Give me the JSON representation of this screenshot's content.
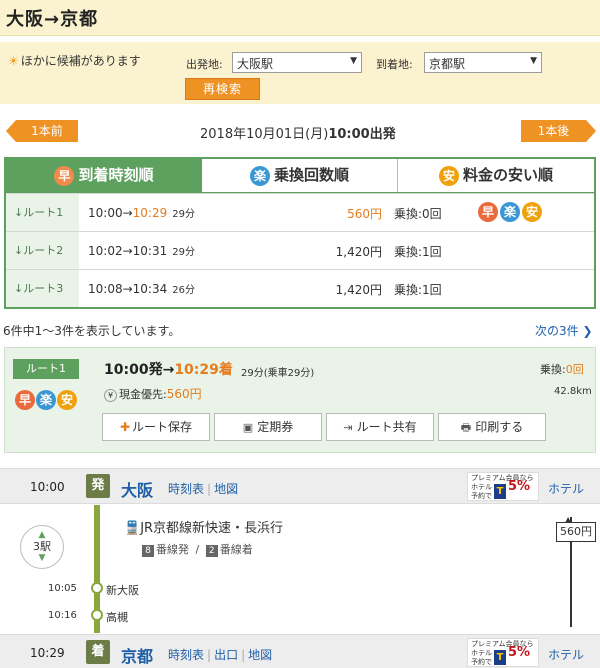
{
  "header": {
    "title": "大阪→京都"
  },
  "search": {
    "alt_notice": "ほかに候補があります",
    "from_label": "出発地:",
    "from_value": "大阪駅",
    "to_label": "到着地:",
    "to_value": "京都駅",
    "research_label": "再検索"
  },
  "datenav": {
    "prev_label": "1本前",
    "next_label": "1本後",
    "date": "2018年10月01日(月)",
    "time": "10:00出発"
  },
  "tabs": {
    "arrival": {
      "icon": "早",
      "label": "到着時刻順"
    },
    "transfer": {
      "icon": "楽",
      "label": "乗換回数順"
    },
    "fare": {
      "icon": "安",
      "label": "料金の安い順"
    }
  },
  "routes": [
    {
      "label": "↓ルート1",
      "dep": "10:00",
      "arrow": "→",
      "arr": "10:29",
      "mins": "29分",
      "fare": "560円",
      "xfer": "乗換:",
      "xfer_count": "0回",
      "badges": [
        "早",
        "楽",
        "安"
      ]
    },
    {
      "label": "↓ルート2",
      "dep": "10:02",
      "arrow": "→",
      "arr": "10:31",
      "mins": "29分",
      "fare": "1,420円",
      "xfer": "乗換:",
      "xfer_count": "1回"
    },
    {
      "label": "↓ルート3",
      "dep": "10:08",
      "arrow": "→",
      "arr": "10:34",
      "mins": "26分",
      "fare": "1,420円",
      "xfer": "乗換:",
      "xfer_count": "1回"
    }
  ],
  "results": {
    "count_text": "6件中1〜3件を表示しています。",
    "next_label": "次の3件"
  },
  "detail": {
    "route_tag": "ルート1",
    "dep": "10:00発",
    "arrow": "→",
    "arr": "10:29着",
    "mins": "29分(乗車29分)",
    "fare_label": "現金優先:",
    "fare_value": "560円",
    "xfer_label": "乗換:",
    "xfer_value": "0回",
    "distance": "42.8km",
    "badges": [
      "早",
      "楽",
      "安"
    ],
    "actions": {
      "save": "ルート保存",
      "pass": "定期券",
      "share": "ルート共有",
      "print": "印刷する"
    }
  },
  "itinerary": {
    "origin": {
      "time": "10:00",
      "mark": "発",
      "name": "大阪",
      "links": [
        "時刻表",
        "地図"
      ],
      "hotel": "ホテル"
    },
    "segment": {
      "stops": "3駅",
      "train": "JR京都線新快速・長浜行",
      "plat_dep_no": "8",
      "plat_dep": "番線発",
      "plat_sep": "/",
      "plat_arr_no": "2",
      "plat_arr": "番線着",
      "fare": "560円",
      "mid_stops": [
        {
          "time": "10:05",
          "name": "新大阪"
        },
        {
          "time": "10:16",
          "name": "高槻"
        }
      ]
    },
    "dest": {
      "time": "10:29",
      "mark": "着",
      "name": "京都",
      "links": [
        "時刻表",
        "出口",
        "地図"
      ],
      "hotel": "ホテル"
    },
    "promo": {
      "line1": "プレミアム会員なら",
      "line2": "ホテル",
      "line3": "予約で",
      "logo": "T",
      "pct": "5%"
    }
  },
  "colors": {
    "accent_orange": "#ef9224",
    "route_green": "#5ea05e",
    "link_blue": "#1f5fa8",
    "rail_green": "#8aa63d"
  }
}
